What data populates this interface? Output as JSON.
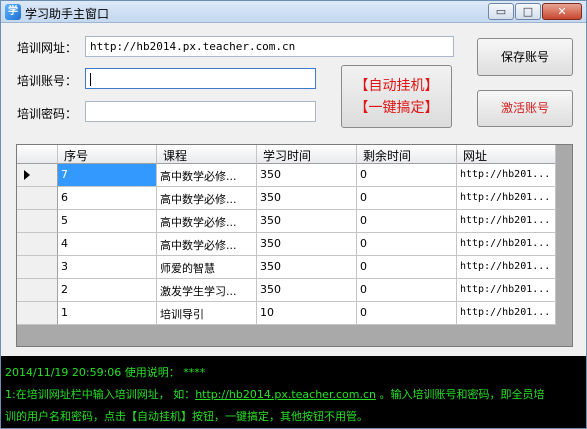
{
  "window": {
    "title": "学习助手主窗口",
    "controls": {
      "minimize": "▭",
      "maximize": "□",
      "close": "✕"
    }
  },
  "form": {
    "url_label": "培训网址：",
    "url_value": "http://hb2014.px.teacher.com.cn",
    "account_label": "培训账号：",
    "account_value": "",
    "password_label": "培训密码：",
    "password_value": ""
  },
  "buttons": {
    "auto_line1": "【自动挂机】",
    "auto_line2": "【一键搞定】",
    "save_account": "保存账号",
    "activate_account": "激活账号"
  },
  "grid": {
    "columns": [
      "序号",
      "课程",
      "学习时间",
      "剩余时间",
      "网址"
    ],
    "rows": [
      {
        "id": "7",
        "course": "高中数学必修...",
        "study": "350",
        "remain": "0",
        "url": "http://hb201..."
      },
      {
        "id": "6",
        "course": "高中数学必修...",
        "study": "350",
        "remain": "0",
        "url": "http://hb201..."
      },
      {
        "id": "5",
        "course": "高中数学必修...",
        "study": "350",
        "remain": "0",
        "url": "http://hb201..."
      },
      {
        "id": "4",
        "course": "高中数学必修...",
        "study": "350",
        "remain": "0",
        "url": "http://hb201..."
      },
      {
        "id": "3",
        "course": "师爱的智慧",
        "study": "350",
        "remain": "0",
        "url": "http://hb201..."
      },
      {
        "id": "2",
        "course": "激发学生学习...",
        "study": "350",
        "remain": "0",
        "url": "http://hb201..."
      },
      {
        "id": "1",
        "course": "培训导引",
        "study": "10",
        "remain": "0",
        "url": "http://hb201..."
      }
    ],
    "selected_row": 0
  },
  "log": {
    "line1": "2014/11/19 20:59:06 使用说明： ****",
    "line2_prefix": "1:在培训网址栏中输入培训网址， 如：",
    "line2_link": "http://hb2014.px.teacher.com.cn",
    "line2_suffix": " 。输入培训账号和密码，即全员培",
    "line3": "训的用户名和密码，点击【自动挂机】按钮，一键搞定，其他按钮不用管。"
  },
  "colors": {
    "log_text": "#26e026",
    "log_bg": "#000000",
    "auto_button_text": "#e01414",
    "activate_text": "#d21e1e",
    "selection": "#3399ff"
  }
}
